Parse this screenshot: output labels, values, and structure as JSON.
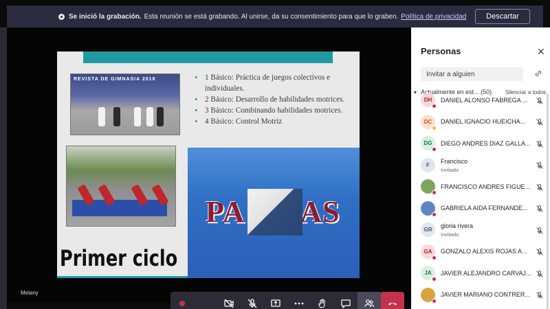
{
  "banner": {
    "bold": "Se inició la grabación.",
    "message": "Esta reunión se está grabando. Al unirse, da su consentimiento para que lo graben.",
    "link": "Política de privacidad",
    "dismiss": "Descartar"
  },
  "slide": {
    "bullets": [
      "1 Básico: Práctica de juegos colectivos e individuales.",
      "2 Básico: Desarrollo de habilidades motrices.",
      "3 Básico: Combinando habilidades motrices.",
      "4 Básico: Control Motriz"
    ],
    "photo_sign": "REVISTA DE GIMNASIA 2018",
    "pausas_left": "PA",
    "pausas_right": "AS",
    "heading": "Primer ciclo"
  },
  "presenter_name": "Melany",
  "panel": {
    "title": "Personas",
    "invite_placeholder": "Invitar a alguien",
    "section_label": "Actualmente en est...",
    "section_count": "(50)",
    "mute_all": "Silenciar a todos",
    "participants": [
      {
        "initials": "DH",
        "name": "DANIEL ALONSO FABREGA ...",
        "sub": "",
        "bg": "#f8d8d8",
        "fg": "#a4262c",
        "dot": "#c4314b"
      },
      {
        "initials": "DC",
        "name": "DANIEL IGNACIO HUEICHA...",
        "sub": "",
        "bg": "#fbe0d0",
        "fg": "#ca5010",
        "dot": "#f8b24c"
      },
      {
        "initials": "DG",
        "name": "DIEGO ANDRES DIAZ GALLA...",
        "sub": "",
        "bg": "#d9f0e0",
        "fg": "#107c41",
        "dot": "#c4314b"
      },
      {
        "initials": "F",
        "name": "Francisco",
        "sub": "Invitado",
        "bg": "#e1e6ee",
        "fg": "#4a5568",
        "dot": ""
      },
      {
        "initials": "",
        "name": "FRANCISCO ANDRES FIGUE...",
        "sub": "",
        "bg": "#7fa45e",
        "fg": "#fff",
        "dot": "#c4314b"
      },
      {
        "initials": "",
        "name": "GABRIELA AIDA FERNANDE...",
        "sub": "",
        "bg": "#5e86c2",
        "fg": "#fff",
        "dot": "#c4314b"
      },
      {
        "initials": "GR",
        "name": "gloria rivera",
        "sub": "Invitado",
        "bg": "#e1e6ee",
        "fg": "#4a5568",
        "dot": ""
      },
      {
        "initials": "GA",
        "name": "GONZALO ALEXIS ROJAS A...",
        "sub": "",
        "bg": "#f8d8d8",
        "fg": "#a4262c",
        "dot": "#c4314b"
      },
      {
        "initials": "JA",
        "name": "JAVIER ALEJANDRO CARVAJ...",
        "sub": "",
        "bg": "#d9f0e0",
        "fg": "#107c41",
        "dot": "#c4314b"
      },
      {
        "initials": "",
        "name": "JAVIER MARIANO CONTRER...",
        "sub": "",
        "bg": "#d8a440",
        "fg": "#fff",
        "dot": "#c4314b"
      }
    ]
  }
}
